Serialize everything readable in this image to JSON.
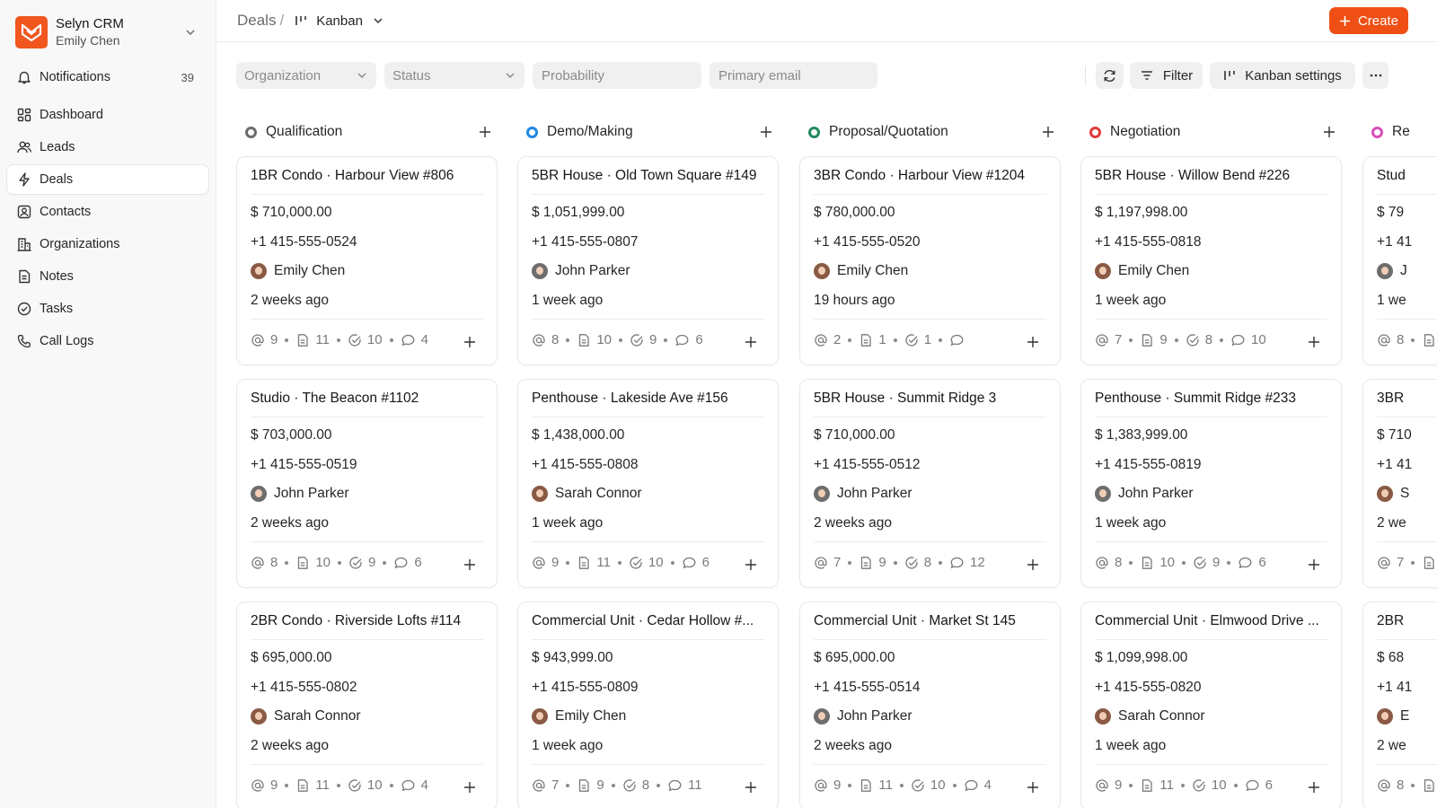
{
  "app": {
    "name": "Selyn CRM",
    "user": "Emily Chen"
  },
  "sidebar": {
    "items": [
      {
        "label": "Notifications",
        "icon": "bell-icon",
        "count": "39"
      },
      {
        "label": "Dashboard",
        "icon": "dashboard-icon"
      },
      {
        "label": "Leads",
        "icon": "users-icon"
      },
      {
        "label": "Deals",
        "icon": "lightning-icon",
        "active": true
      },
      {
        "label": "Contacts",
        "icon": "contact-icon"
      },
      {
        "label": "Organizations",
        "icon": "building-icon"
      },
      {
        "label": "Notes",
        "icon": "note-icon"
      },
      {
        "label": "Tasks",
        "icon": "check-circle-icon"
      },
      {
        "label": "Call Logs",
        "icon": "phone-icon"
      }
    ]
  },
  "header": {
    "breadcrumb_root": "Deals",
    "breadcrumb_sep": "/",
    "view_label": "Kanban",
    "create_label": "Create"
  },
  "filters": {
    "organization": "Organization",
    "status": "Status",
    "probability_placeholder": "Probability",
    "email_placeholder": "Primary email",
    "filter_label": "Filter",
    "kanban_settings_label": "Kanban settings"
  },
  "colors": {
    "accent": "#ef4f15",
    "qualification": "#6b6b6b",
    "demo": "#1f88e5",
    "proposal": "#23895f",
    "negotiation": "#e03b3b",
    "ready": "#d84fb5"
  },
  "columns": [
    {
      "title": "Qualification",
      "cards": [
        {
          "title": "1BR Condo · Harbour View #806",
          "amount": "$ 710,000.00",
          "phone": "+1 415-555-0524",
          "owner": "Emily Chen",
          "time": "2 weeks ago",
          "emails": "9",
          "notes": "11",
          "tasks": "10",
          "comments": "4"
        },
        {
          "title": "Studio · The Beacon #1102",
          "amount": "$ 703,000.00",
          "phone": "+1 415-555-0519",
          "owner": "John Parker",
          "time": "2 weeks ago",
          "emails": "8",
          "notes": "10",
          "tasks": "9",
          "comments": "6"
        },
        {
          "title": "2BR Condo · Riverside Lofts #114",
          "amount": "$ 695,000.00",
          "phone": "+1 415-555-0802",
          "owner": "Sarah Connor",
          "time": "2 weeks ago",
          "emails": "9",
          "notes": "11",
          "tasks": "10",
          "comments": "4"
        }
      ]
    },
    {
      "title": "Demo/Making",
      "cards": [
        {
          "title": "5BR House · Old Town Square #149",
          "amount": "$ 1,051,999.00",
          "phone": "+1 415-555-0807",
          "owner": "John Parker",
          "time": "1 week ago",
          "emails": "8",
          "notes": "10",
          "tasks": "9",
          "comments": "6"
        },
        {
          "title": "Penthouse · Lakeside Ave #156",
          "amount": "$ 1,438,000.00",
          "phone": "+1 415-555-0808",
          "owner": "Sarah Connor",
          "time": "1 week ago",
          "emails": "9",
          "notes": "11",
          "tasks": "10",
          "comments": "6"
        },
        {
          "title": "Commercial Unit · Cedar Hollow #...",
          "amount": "$ 943,999.00",
          "phone": "+1 415-555-0809",
          "owner": "Emily Chen",
          "time": "1 week ago",
          "emails": "7",
          "notes": "9",
          "tasks": "8",
          "comments": "11"
        }
      ]
    },
    {
      "title": "Proposal/Quotation",
      "cards": [
        {
          "title": "3BR Condo · Harbour View #1204",
          "amount": "$ 780,000.00",
          "phone": "+1 415-555-0520",
          "owner": "Emily Chen",
          "time": "19 hours ago",
          "emails": "2",
          "notes": "1",
          "tasks": "1",
          "comments": ""
        },
        {
          "title": "5BR House · Summit Ridge 3",
          "amount": "$ 710,000.00",
          "phone": "+1 415-555-0512",
          "owner": "John Parker",
          "time": "2 weeks ago",
          "emails": "7",
          "notes": "9",
          "tasks": "8",
          "comments": "12"
        },
        {
          "title": "Commercial Unit · Market St 145",
          "amount": "$ 695,000.00",
          "phone": "+1 415-555-0514",
          "owner": "John Parker",
          "time": "2 weeks ago",
          "emails": "9",
          "notes": "11",
          "tasks": "10",
          "comments": "4"
        }
      ]
    },
    {
      "title": "Negotiation",
      "cards": [
        {
          "title": "5BR House · Willow Bend #226",
          "amount": "$ 1,197,998.00",
          "phone": "+1 415-555-0818",
          "owner": "Emily Chen",
          "time": "1 week ago",
          "emails": "7",
          "notes": "9",
          "tasks": "8",
          "comments": "10"
        },
        {
          "title": "Penthouse · Summit Ridge #233",
          "amount": "$ 1,383,999.00",
          "phone": "+1 415-555-0819",
          "owner": "John Parker",
          "time": "1 week ago",
          "emails": "8",
          "notes": "10",
          "tasks": "9",
          "comments": "6"
        },
        {
          "title": "Commercial Unit · Elmwood Drive ...",
          "amount": "$ 1,099,998.00",
          "phone": "+1 415-555-0820",
          "owner": "Sarah Connor",
          "time": "1 week ago",
          "emails": "9",
          "notes": "11",
          "tasks": "10",
          "comments": "6"
        }
      ]
    },
    {
      "title": "Re",
      "cards": [
        {
          "title": "Stud",
          "amount": "$ 79",
          "phone": "+1 41",
          "owner": "J",
          "time": "1 we",
          "emails": "8",
          "notes": "",
          "tasks": "",
          "comments": ""
        },
        {
          "title": "3BR",
          "amount": "$ 710",
          "phone": "+1 41",
          "owner": "S",
          "time": "2 we",
          "emails": "7",
          "notes": "",
          "tasks": "",
          "comments": ""
        },
        {
          "title": "2BR",
          "amount": "$ 68",
          "phone": "+1 41",
          "owner": "E",
          "time": "2 we",
          "emails": "8",
          "notes": "",
          "tasks": "",
          "comments": ""
        }
      ]
    }
  ]
}
